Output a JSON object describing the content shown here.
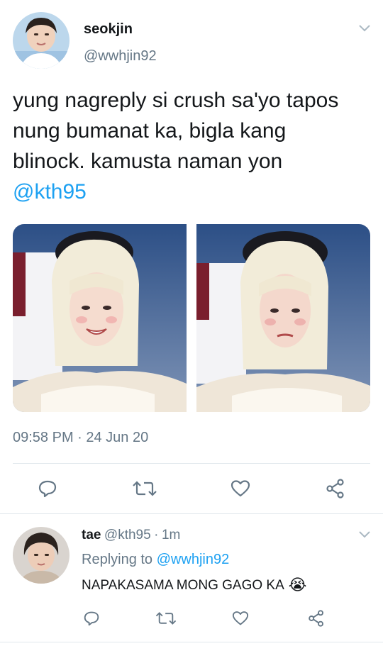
{
  "tweet": {
    "author_name": "seokjin",
    "author_handle": "@wwhjin92",
    "text_line1": "yung nagreply si crush sa'yo tapos",
    "text_line2": "nung bumanat ka, bigla kang",
    "text_line3": "blinock. kamusta naman yon",
    "mention": "@kth95",
    "timestamp": "09:58 PM · 24 Jun 20"
  },
  "reply": {
    "author_name": "tae",
    "author_handle": "@kth95",
    "separator": "·",
    "time": "1m",
    "replying_label": "Replying to",
    "replying_handle": "@wwhjin92",
    "text": "NAPAKASAMA MONG GAGO KA",
    "emoji": "😭"
  },
  "colors": {
    "link": "#1da1f2",
    "secondary_text": "#657786",
    "divider": "#e1e8ed",
    "icon": "#657786"
  }
}
